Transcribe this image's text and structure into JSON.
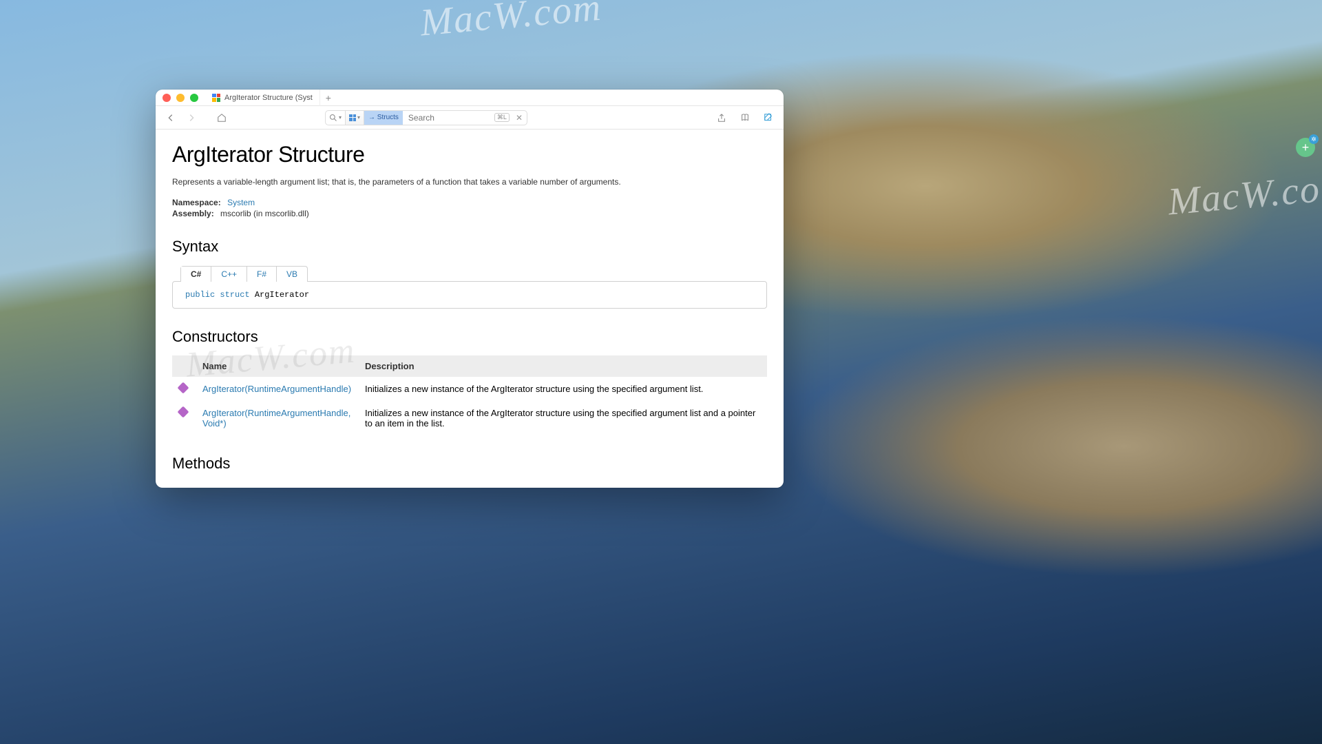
{
  "window": {
    "tab_title": "ArgIterator Structure (Syst"
  },
  "toolbar": {
    "filter_chip": "→ Structs",
    "search_placeholder": "Search",
    "shortcut_hint": "⌘L"
  },
  "page": {
    "title": "ArgIterator Structure",
    "description": "Represents a variable-length argument list; that is, the parameters of a function that takes a variable number of arguments.",
    "namespace_label": "Namespace:",
    "namespace_value": "System",
    "assembly_label": "Assembly:",
    "assembly_value": "mscorlib (in mscorlib.dll)"
  },
  "sections": {
    "syntax": "Syntax",
    "constructors": "Constructors",
    "methods": "Methods"
  },
  "syntax": {
    "tabs": {
      "csharp": "C#",
      "cpp": "C++",
      "fsharp": "F#",
      "vb": "VB"
    },
    "keywords": "public struct",
    "typename": "ArgIterator"
  },
  "table": {
    "col_name": "Name",
    "col_desc": "Description",
    "rows": [
      {
        "name": "ArgIterator(RuntimeArgumentHandle)",
        "desc": "Initializes a new instance of the ArgIterator structure using the specified argument list."
      },
      {
        "name": "ArgIterator(RuntimeArgumentHandle, Void*)",
        "desc": "Initializes a new instance of the ArgIterator structure using the specified argument list and a pointer to an item in the list."
      }
    ]
  },
  "watermark": "MacW.com"
}
